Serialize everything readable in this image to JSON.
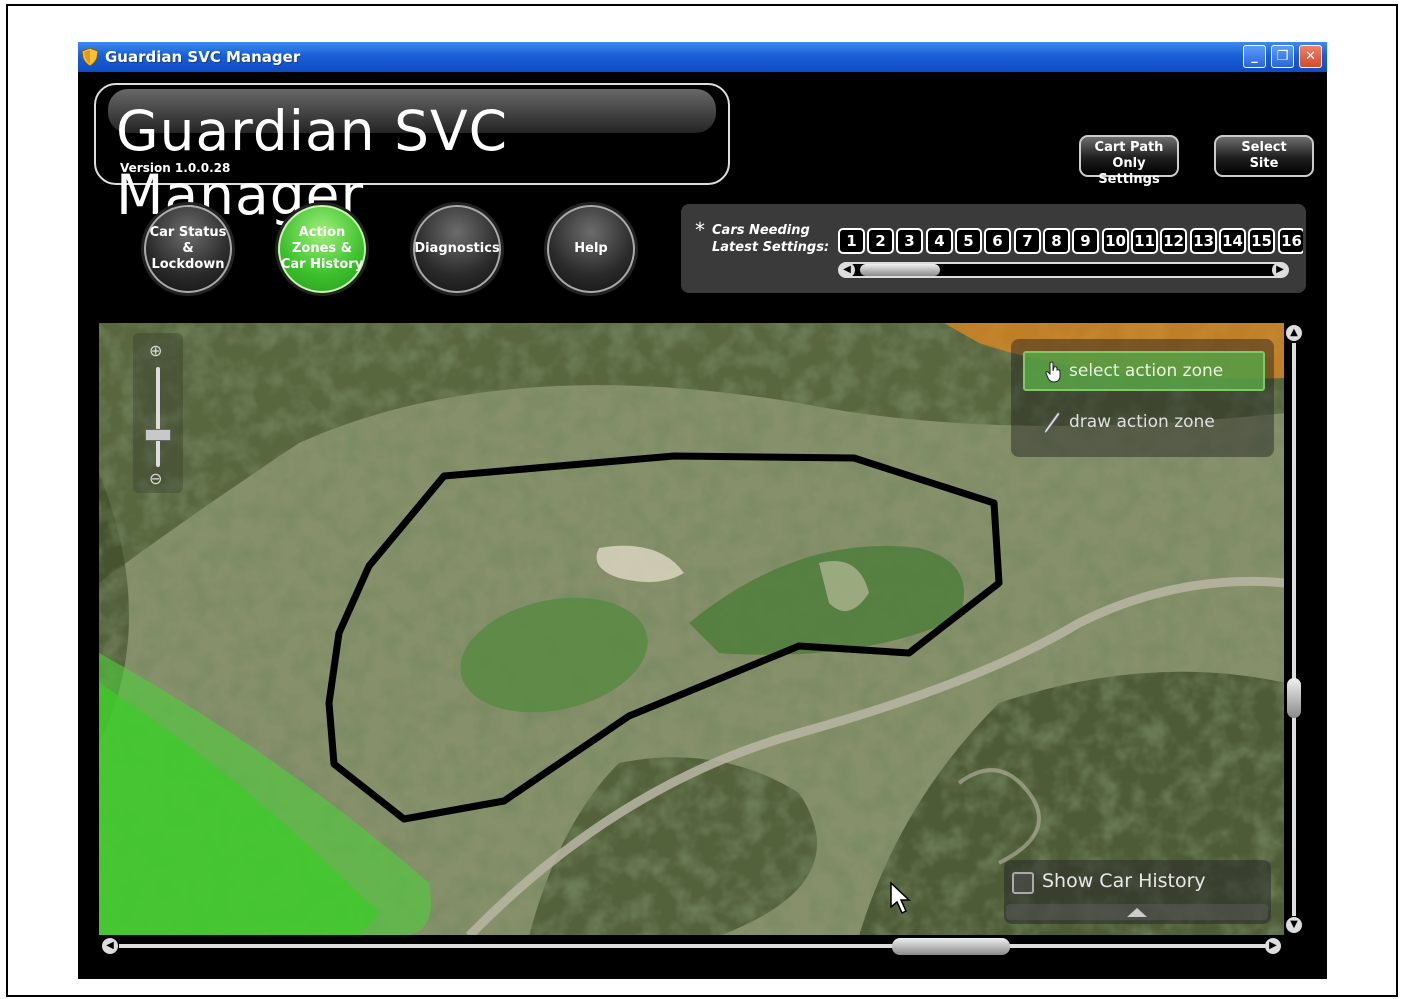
{
  "window": {
    "title": "Guardian SVC Manager",
    "controls": {
      "minimize": "_",
      "restore": "❐",
      "close": "✕"
    }
  },
  "header": {
    "logo_title": "Guardian SVC Manager",
    "version": "Version 1.0.0.28",
    "cart_path_button": "Cart Path Only Settings",
    "select_site_button": "Select Site"
  },
  "nav": [
    {
      "label": "Car Status & Lockdown",
      "active": false
    },
    {
      "label": "Action Zones & Car History",
      "active": true
    },
    {
      "label": "Diagnostics",
      "active": false
    },
    {
      "label": "Help",
      "active": false
    }
  ],
  "cars_needing": {
    "star": "*",
    "label_line1": "Cars Needing",
    "label_line2": "Latest Settings:",
    "numbers": [
      "1",
      "2",
      "3",
      "4",
      "5",
      "6",
      "7",
      "8",
      "9",
      "10",
      "11",
      "12",
      "13",
      "14",
      "15",
      "16"
    ]
  },
  "map_tools": {
    "select_label": "select action zone",
    "draw_label": "draw action zone",
    "show_history_label": "Show Car History",
    "zoom_in": "⊕",
    "zoom_out": "⊖"
  },
  "colors": {
    "active_nav": "#3bbf2c",
    "zone_outline": "#000000",
    "green_zone": "#3fcf30",
    "orange_zone": "#e08a2a"
  },
  "icons": [
    "shield-icon",
    "hand-cursor-icon",
    "pencil-icon",
    "zoom-in-icon",
    "zoom-out-icon",
    "scroll-left-icon",
    "scroll-right-icon",
    "scroll-up-icon",
    "scroll-down-icon",
    "expand-up-icon",
    "mouse-pointer-icon"
  ]
}
